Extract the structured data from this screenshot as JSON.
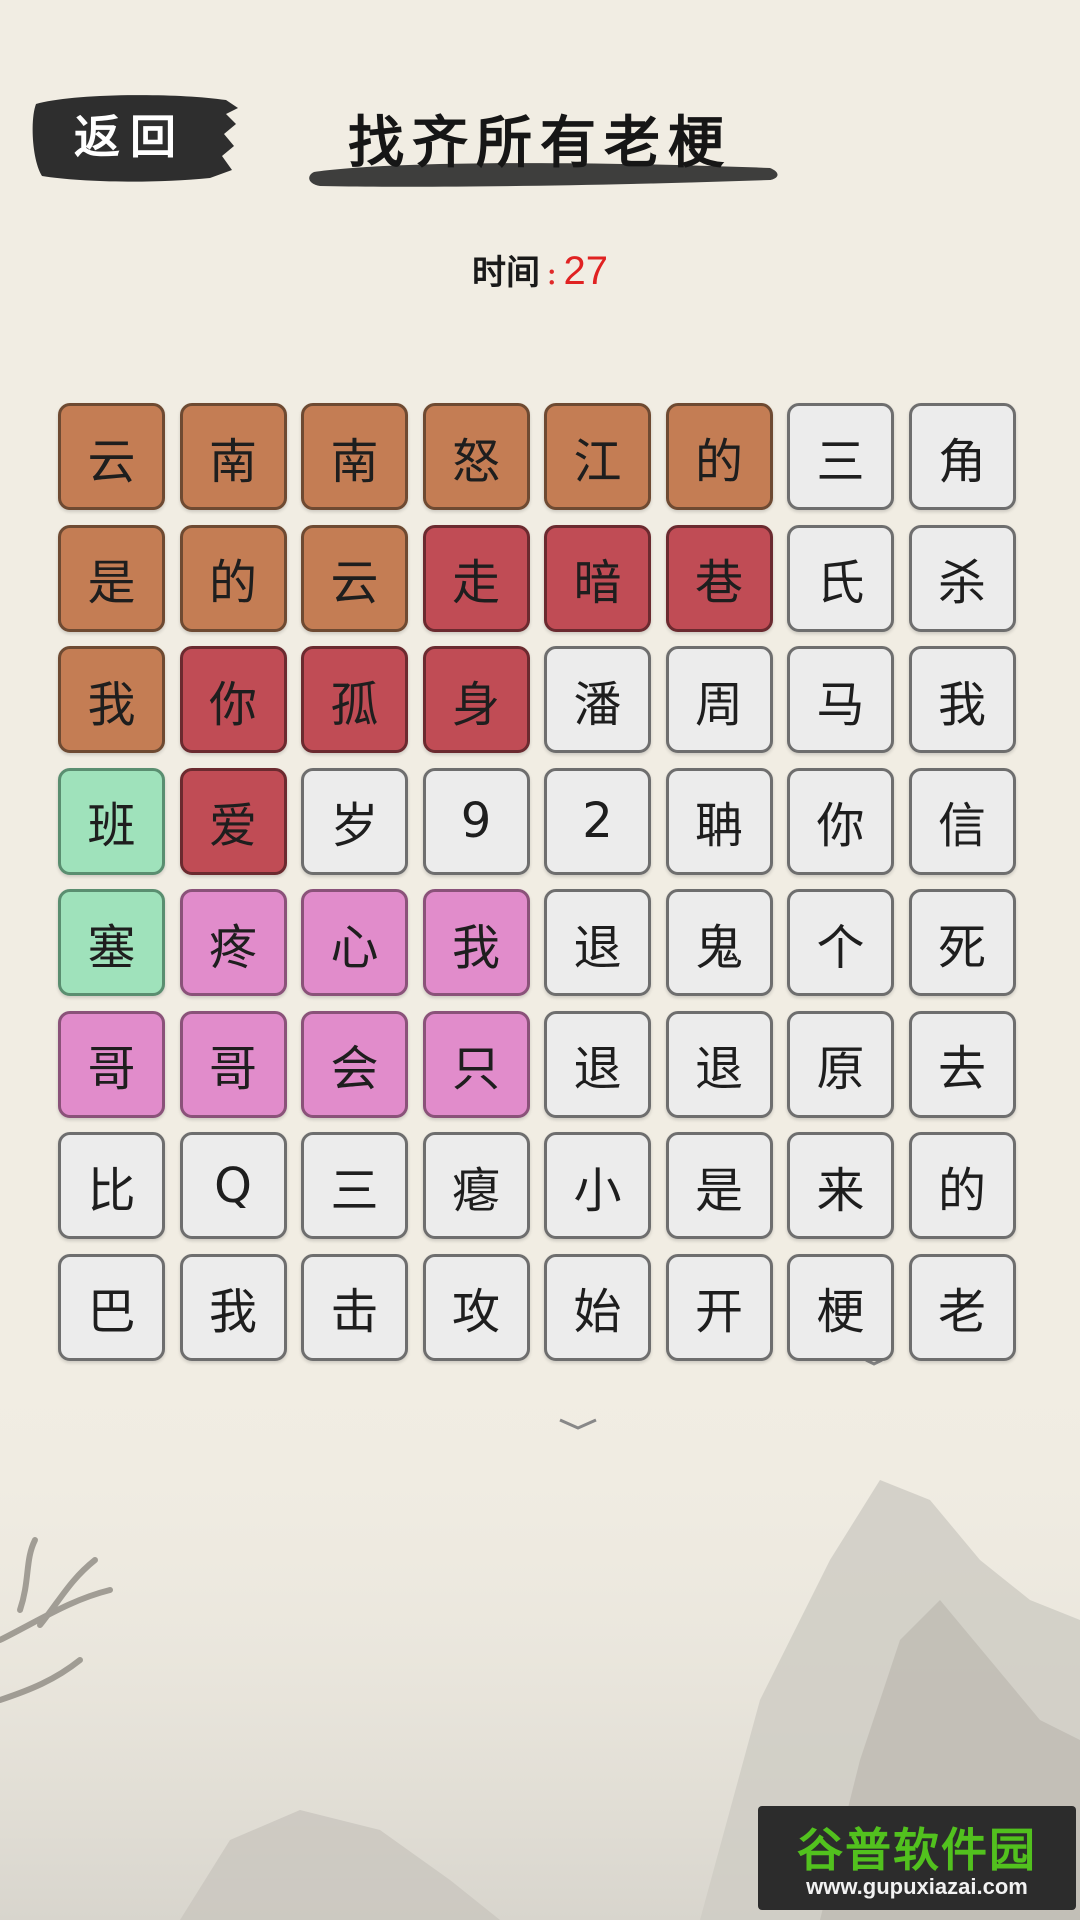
{
  "header": {
    "back_label": "返回",
    "title": "找齐所有老梗"
  },
  "timer": {
    "label": "时间",
    "separator": ":",
    "value": "27"
  },
  "colors": {
    "brown": "#c47d54",
    "red": "#c04c55",
    "green": "#9fe2bb",
    "pink": "#e18ccb",
    "default": "#ececec",
    "timer_value": "#e02222"
  },
  "board": {
    "rows": [
      [
        {
          "char": "云",
          "color": "brown"
        },
        {
          "char": "南",
          "color": "brown"
        },
        {
          "char": "南",
          "color": "brown"
        },
        {
          "char": "怒",
          "color": "brown"
        },
        {
          "char": "江",
          "color": "brown"
        },
        {
          "char": "的",
          "color": "brown"
        },
        {
          "char": "三",
          "color": "default"
        },
        {
          "char": "角",
          "color": "default"
        }
      ],
      [
        {
          "char": "是",
          "color": "brown"
        },
        {
          "char": "的",
          "color": "brown"
        },
        {
          "char": "云",
          "color": "brown"
        },
        {
          "char": "走",
          "color": "red"
        },
        {
          "char": "暗",
          "color": "red"
        },
        {
          "char": "巷",
          "color": "red"
        },
        {
          "char": "氏",
          "color": "default"
        },
        {
          "char": "杀",
          "color": "default"
        }
      ],
      [
        {
          "char": "我",
          "color": "brown"
        },
        {
          "char": "你",
          "color": "red"
        },
        {
          "char": "孤",
          "color": "red"
        },
        {
          "char": "身",
          "color": "red"
        },
        {
          "char": "潘",
          "color": "default"
        },
        {
          "char": "周",
          "color": "default"
        },
        {
          "char": "马",
          "color": "default"
        },
        {
          "char": "我",
          "color": "default"
        }
      ],
      [
        {
          "char": "班",
          "color": "green"
        },
        {
          "char": "爱",
          "color": "red"
        },
        {
          "char": "岁",
          "color": "default"
        },
        {
          "char": "9",
          "color": "default"
        },
        {
          "char": "2",
          "color": "default"
        },
        {
          "char": "聃",
          "color": "default"
        },
        {
          "char": "你",
          "color": "default"
        },
        {
          "char": "信",
          "color": "default"
        }
      ],
      [
        {
          "char": "塞",
          "color": "green"
        },
        {
          "char": "疼",
          "color": "pink"
        },
        {
          "char": "心",
          "color": "pink"
        },
        {
          "char": "我",
          "color": "pink"
        },
        {
          "char": "退",
          "color": "default"
        },
        {
          "char": "鬼",
          "color": "default"
        },
        {
          "char": "个",
          "color": "default"
        },
        {
          "char": "死",
          "color": "default"
        }
      ],
      [
        {
          "char": "哥",
          "color": "pink"
        },
        {
          "char": "哥",
          "color": "pink"
        },
        {
          "char": "会",
          "color": "pink"
        },
        {
          "char": "只",
          "color": "pink"
        },
        {
          "char": "退",
          "color": "default"
        },
        {
          "char": "退",
          "color": "default"
        },
        {
          "char": "原",
          "color": "default"
        },
        {
          "char": "去",
          "color": "default"
        }
      ],
      [
        {
          "char": "比",
          "color": "default"
        },
        {
          "char": "Q",
          "color": "default"
        },
        {
          "char": "三",
          "color": "default"
        },
        {
          "char": "瘪",
          "color": "default"
        },
        {
          "char": "小",
          "color": "default"
        },
        {
          "char": "是",
          "color": "default"
        },
        {
          "char": "来",
          "color": "default"
        },
        {
          "char": "的",
          "color": "default"
        }
      ],
      [
        {
          "char": "巴",
          "color": "default"
        },
        {
          "char": "我",
          "color": "default"
        },
        {
          "char": "击",
          "color": "default"
        },
        {
          "char": "攻",
          "color": "default"
        },
        {
          "char": "始",
          "color": "default"
        },
        {
          "char": "开",
          "color": "default"
        },
        {
          "char": "梗",
          "color": "default"
        },
        {
          "char": "老",
          "color": "default"
        }
      ]
    ]
  },
  "watermark": {
    "brand": "谷普软件园",
    "site": "www.gupuxiazai.com"
  }
}
